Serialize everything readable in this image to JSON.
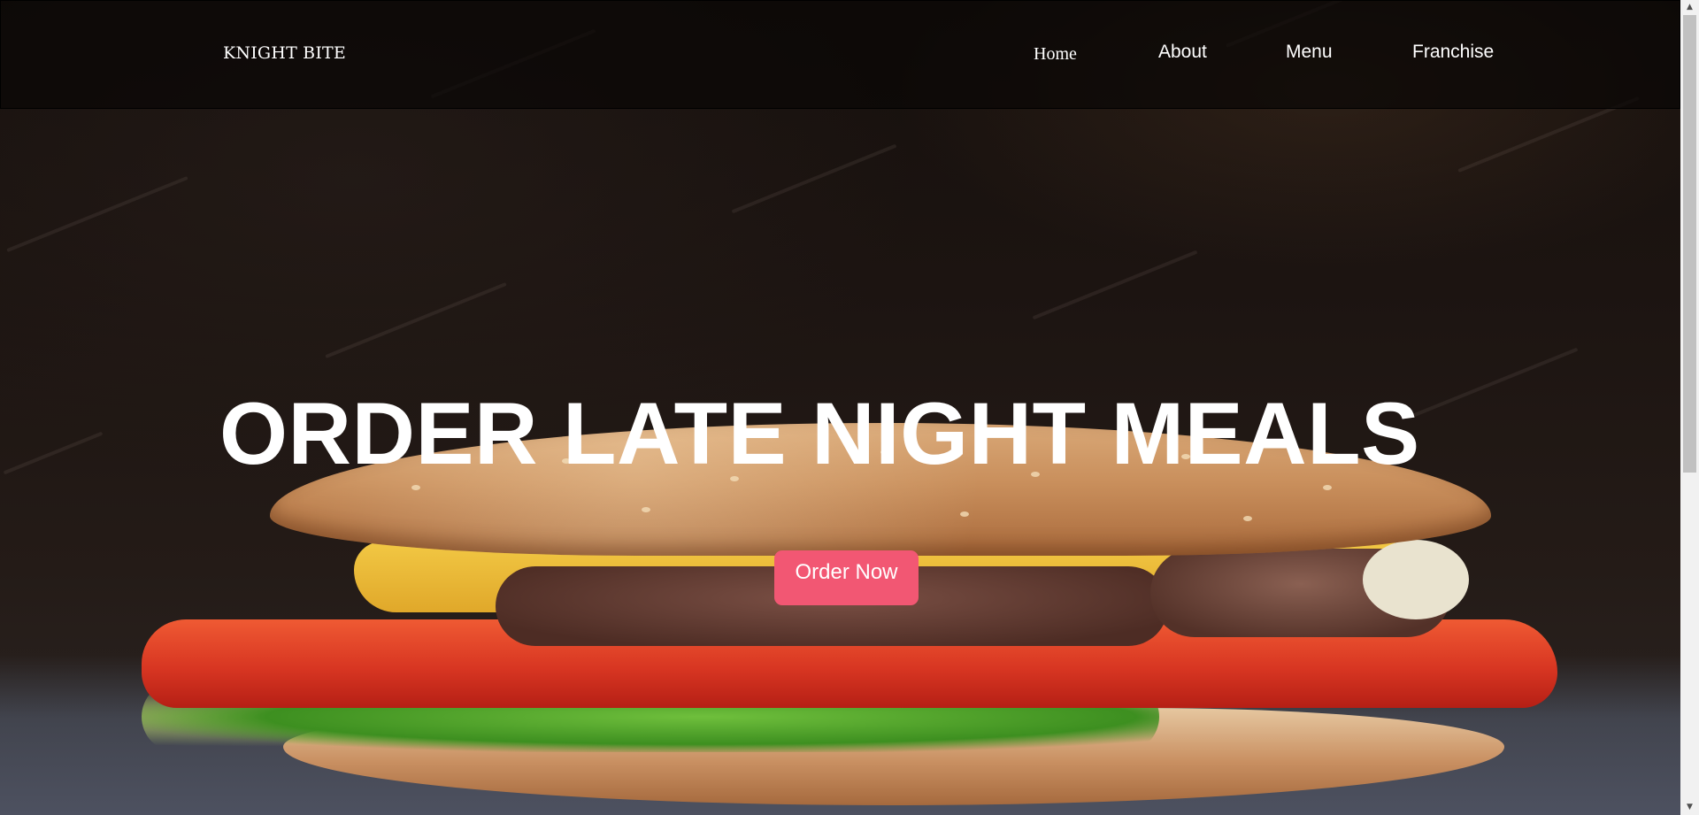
{
  "header": {
    "brand": "KNIGHT BITE",
    "nav": {
      "home": "Home",
      "about": "About",
      "menu": "Menu",
      "franchise": "Franchise"
    }
  },
  "hero": {
    "title": "ORDER LATE NIGHT MEALS",
    "cta_label": "Order Now",
    "background_image": "burger-photo"
  },
  "colors": {
    "cta_background": "#f25773",
    "text": "#ffffff",
    "header_background": "#0a0706"
  },
  "scrollbar": {
    "up_icon": "scroll-up-arrow-icon",
    "down_icon": "scroll-down-arrow-icon"
  }
}
